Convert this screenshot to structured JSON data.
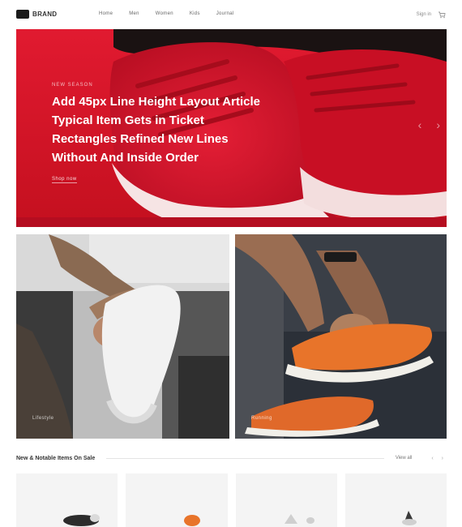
{
  "header": {
    "brand": "BRAND",
    "nav": [
      "Home",
      "Men",
      "Women",
      "Kids",
      "Journal"
    ],
    "sign_in": "Sign in"
  },
  "hero": {
    "eyebrow": "New season",
    "title": "Add 45px Line Height Layout Article Typical Item Gets in Ticket Rectangles Refined New Lines Without And Inside Order",
    "link": "Shop now"
  },
  "tiles": {
    "left_caption": "Lifestyle",
    "right_caption": "Running"
  },
  "section": {
    "title": "New & Notable Items On Sale",
    "view_all": "View all",
    "arrows": "‹ ›"
  },
  "colors": {
    "hero_red": "#d9132a",
    "sneaker_orange": "#e8742a"
  }
}
